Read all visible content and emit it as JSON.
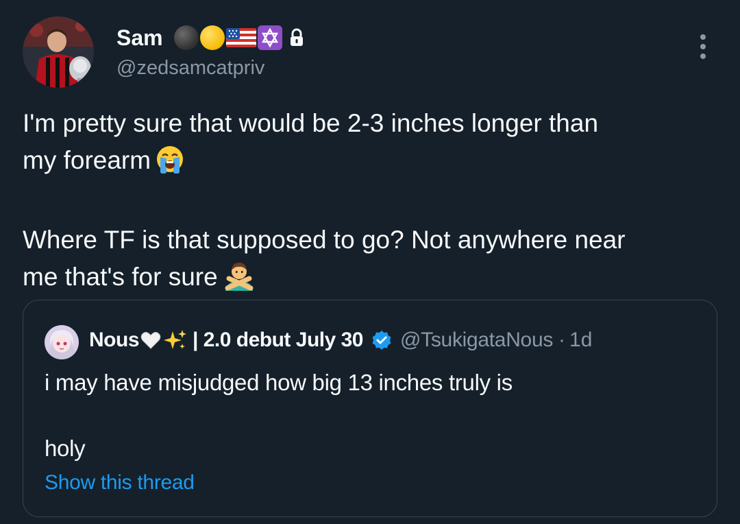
{
  "tweet": {
    "author": {
      "name": "Sam",
      "handle": "@zedsamcatpriv",
      "badges": [
        "black-circle-emoji",
        "yellow-circle-emoji",
        "us-flag-emoji",
        "star-of-david-emoji"
      ],
      "protected_icon": "lock-icon"
    },
    "text_lines": [
      "I'm pretty sure that would be 2-3 inches longer than",
      "my forearm",
      "Where TF is that supposed to go?  Not anywhere near",
      "me that's for sure"
    ],
    "emojis": [
      "loudly-crying-face-emoji",
      "man-gesturing-no-emoji"
    ],
    "more_icon": "more-options-icon"
  },
  "quote": {
    "author": {
      "name": "Nous",
      "name_suffix": "| 2.0 debut July 30",
      "name_emojis": [
        "white-heart-emoji",
        "sparkles-emoji"
      ],
      "handle": "@TsukigataNous",
      "separator": "·",
      "time": "1d",
      "verified_icon": "verified-badge-icon"
    },
    "text_lines": [
      "i may have misjudged how big 13 inches truly is",
      "holy"
    ],
    "show_thread_label": "Show this thread"
  },
  "colors": {
    "background": "#15202b",
    "text": "#f7f9f9",
    "secondary": "#8b98a5",
    "accent": "#1d9bf0",
    "border": "#38444d"
  }
}
